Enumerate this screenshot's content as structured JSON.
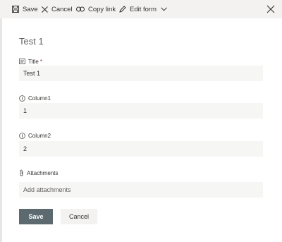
{
  "toolbar": {
    "save_label": "Save",
    "cancel_label": "Cancel",
    "copy_link_label": "Copy link",
    "edit_form_label": "Edit form",
    "icons": [
      "save-icon",
      "cancel-x-icon",
      "link-icon",
      "pencil-icon",
      "chevron-down-icon",
      "close-icon"
    ]
  },
  "form": {
    "title": "Test 1",
    "fields": [
      {
        "label": "Title",
        "required_mark": "*",
        "value": "Test 1",
        "icon": "text-field-icon"
      },
      {
        "label": "Column1",
        "value": "1",
        "icon": "number-field-icon"
      },
      {
        "label": "Column2",
        "value": "2",
        "icon": "number-field-icon"
      }
    ],
    "attachments": {
      "label": "Attachments",
      "placeholder": "Add attachments",
      "icon": "paperclip-icon"
    }
  },
  "actions": {
    "save_label": "Save",
    "cancel_label": "Cancel"
  },
  "colors": {
    "toolbar_bg": "#f3f2f1",
    "input_bg": "#f6f6f5",
    "primary_button": "#5c6a70",
    "required": "#a4262c"
  }
}
